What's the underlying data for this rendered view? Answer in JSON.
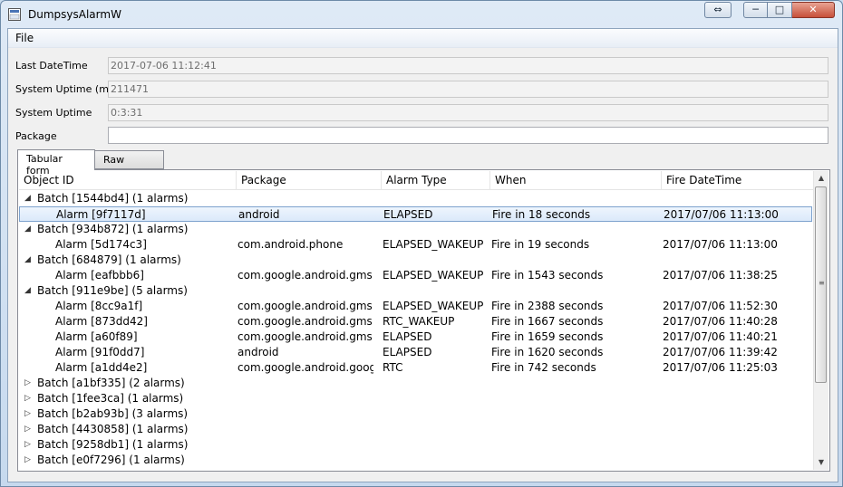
{
  "window": {
    "title": "DumpsysAlarmW"
  },
  "menu": {
    "file": "File"
  },
  "fields": [
    {
      "label": "Last DateTime",
      "value": "2017-07-06 11:12:41"
    },
    {
      "label": "System Uptime (ms)",
      "value": "211471"
    },
    {
      "label": "System Uptime",
      "value": "0:3:31"
    },
    {
      "label": "Package",
      "value": ""
    }
  ],
  "tabs": [
    {
      "label": "Tabular form",
      "active": true
    },
    {
      "label": "Raw source",
      "active": false
    }
  ],
  "columns": [
    "Object ID",
    "Package",
    "Alarm Type",
    "When",
    "Fire DateTime"
  ],
  "rows": [
    {
      "level": 0,
      "expanded": true,
      "id": "Batch [1544bd4] (1 alarms)"
    },
    {
      "level": 1,
      "selected": true,
      "id": "Alarm [9f7117d]",
      "package": "android",
      "type": "ELAPSED",
      "when": "Fire in 18 seconds",
      "fire": "2017/07/06 11:13:00"
    },
    {
      "level": 0,
      "expanded": true,
      "id": "Batch [934b872] (1 alarms)"
    },
    {
      "level": 1,
      "id": "Alarm [5d174c3]",
      "package": "com.android.phone",
      "type": "ELAPSED_WAKEUP",
      "when": "Fire in 19 seconds",
      "fire": "2017/07/06 11:13:00"
    },
    {
      "level": 0,
      "expanded": true,
      "id": "Batch [684879] (1 alarms)"
    },
    {
      "level": 1,
      "id": "Alarm [eafbbb6]",
      "package": "com.google.android.gms",
      "type": "ELAPSED_WAKEUP",
      "when": "Fire in 1543 seconds",
      "fire": "2017/07/06 11:38:25"
    },
    {
      "level": 0,
      "expanded": true,
      "id": "Batch [911e9be] (5 alarms)"
    },
    {
      "level": 1,
      "id": "Alarm [8cc9a1f]",
      "package": "com.google.android.gms",
      "type": "ELAPSED_WAKEUP",
      "when": "Fire in 2388 seconds",
      "fire": "2017/07/06 11:52:30"
    },
    {
      "level": 1,
      "id": "Alarm [873dd42]",
      "package": "com.google.android.gms",
      "type": "RTC_WAKEUP",
      "when": "Fire in 1667 seconds",
      "fire": "2017/07/06 11:40:28"
    },
    {
      "level": 1,
      "id": "Alarm [a60f89]",
      "package": "com.google.android.gms",
      "type": "ELAPSED",
      "when": "Fire in 1659 seconds",
      "fire": "2017/07/06 11:40:21"
    },
    {
      "level": 1,
      "id": "Alarm [91f0dd7]",
      "package": "android",
      "type": "ELAPSED",
      "when": "Fire in 1620 seconds",
      "fire": "2017/07/06 11:39:42"
    },
    {
      "level": 1,
      "id": "Alarm [a1dd4e2]",
      "package": "com.google.android.googl...",
      "type": "RTC",
      "when": "Fire in 742 seconds",
      "fire": "2017/07/06 11:25:03"
    },
    {
      "level": 0,
      "expanded": false,
      "id": "Batch [a1bf335] (2 alarms)"
    },
    {
      "level": 0,
      "expanded": false,
      "id": "Batch [1fee3ca] (1 alarms)"
    },
    {
      "level": 0,
      "expanded": false,
      "id": "Batch [b2ab93b] (3 alarms)"
    },
    {
      "level": 0,
      "expanded": false,
      "id": "Batch [4430858] (1 alarms)"
    },
    {
      "level": 0,
      "expanded": false,
      "id": "Batch [9258db1] (1 alarms)"
    },
    {
      "level": 0,
      "expanded": false,
      "id": "Batch [e0f7296] (1 alarms)"
    }
  ]
}
